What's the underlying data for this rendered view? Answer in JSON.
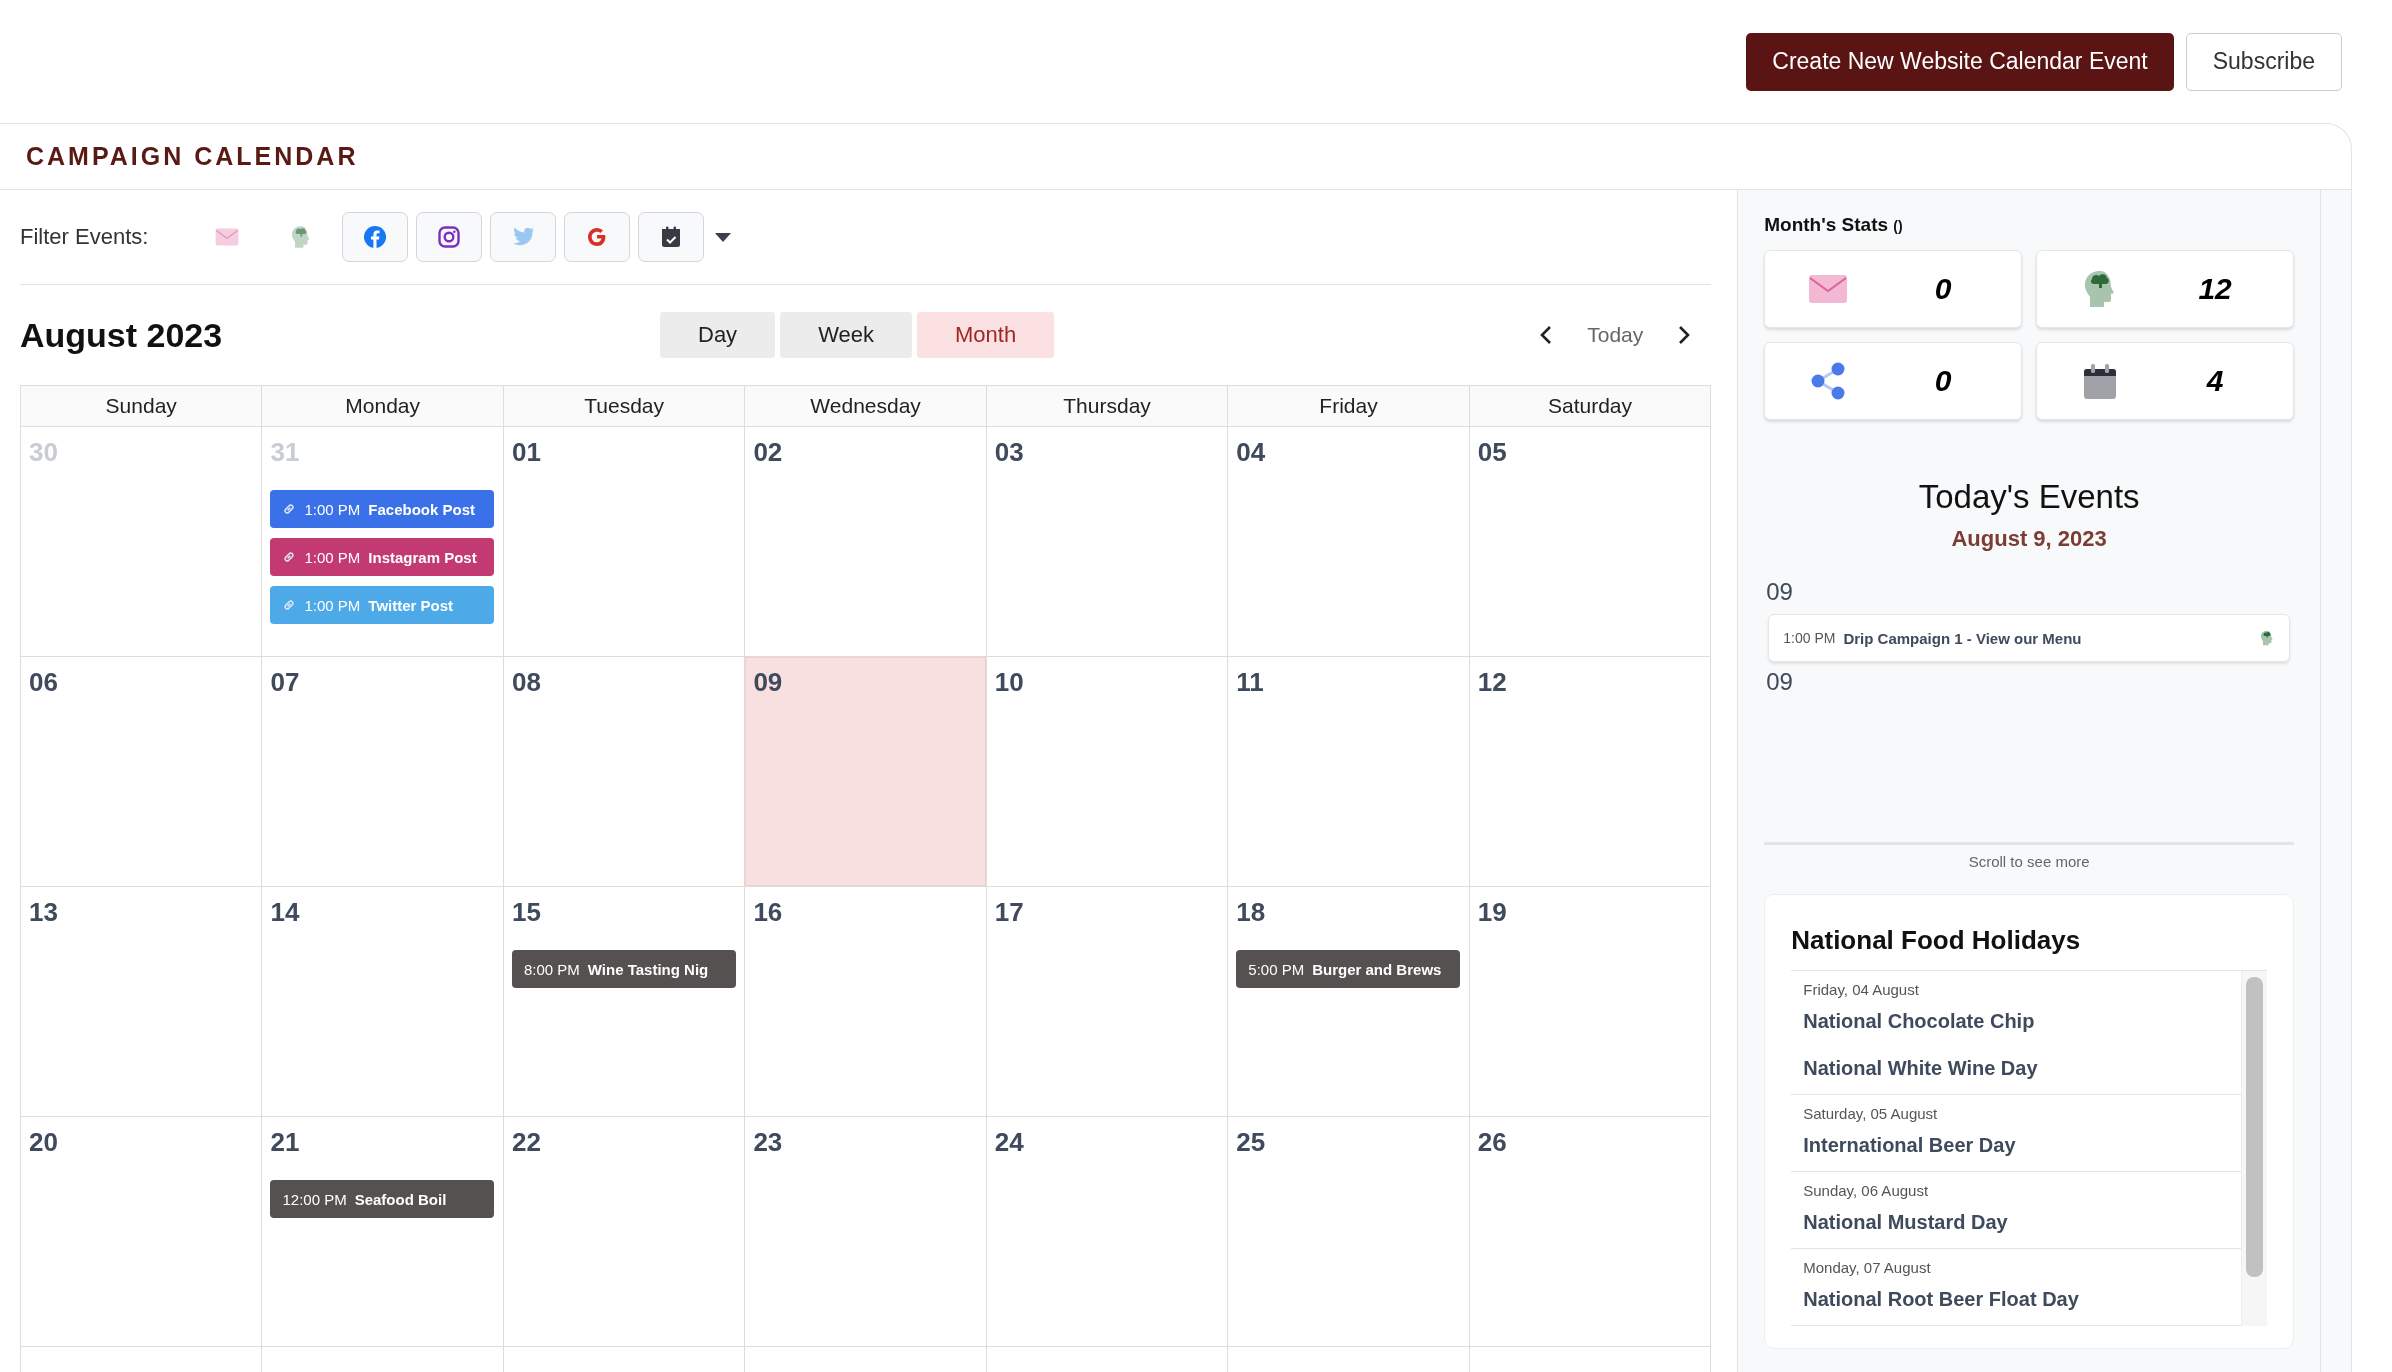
{
  "header_buttons": [
    {
      "label": "Create New Website Calendar Event",
      "kind": "primary"
    },
    {
      "label": "Subscribe",
      "kind": "outline"
    }
  ],
  "title": "CAMPAIGN CALENDAR",
  "filters": {
    "label": "Filter Events:",
    "items": [
      {
        "kind": "email"
      },
      {
        "kind": "drip"
      },
      {
        "kind": "facebook"
      },
      {
        "kind": "instagram"
      },
      {
        "kind": "twitter"
      },
      {
        "kind": "google"
      },
      {
        "kind": "calendar"
      }
    ]
  },
  "calendar": {
    "month_title": "August 2023",
    "views": [
      {
        "label": "Day",
        "selected": false
      },
      {
        "label": "Week",
        "selected": false
      },
      {
        "label": "Month",
        "selected": true
      }
    ],
    "today_button": "Today",
    "weekdays": [
      "Sunday",
      "Monday",
      "Tuesday",
      "Wednesday",
      "Thursday",
      "Friday",
      "Saturday"
    ],
    "weeks": [
      {
        "days": [
          {
            "number": "30",
            "outside": true,
            "today": false
          },
          {
            "number": "31",
            "outside": true,
            "today": false,
            "events": [
              {
                "time": "1:00 PM",
                "title": "Facebook Post",
                "color": "#3b71e8",
                "linked": true
              },
              {
                "time": "1:00 PM",
                "title": "Instagram Post",
                "color": "#c33a72",
                "linked": true
              },
              {
                "time": "1:00 PM",
                "title": "Twitter Post",
                "color": "#4ea9e8",
                "linked": true
              }
            ]
          },
          {
            "number": "01",
            "outside": false,
            "today": false
          },
          {
            "number": "02",
            "outside": false,
            "today": false
          },
          {
            "number": "03",
            "outside": false,
            "today": false
          },
          {
            "number": "04",
            "outside": false,
            "today": false
          },
          {
            "number": "05",
            "outside": false,
            "today": false
          }
        ]
      },
      {
        "days": [
          {
            "number": "06",
            "outside": false,
            "today": false
          },
          {
            "number": "07",
            "outside": false,
            "today": false
          },
          {
            "number": "08",
            "outside": false,
            "today": false
          },
          {
            "number": "09",
            "outside": false,
            "today": true
          },
          {
            "number": "10",
            "outside": false,
            "today": false
          },
          {
            "number": "11",
            "outside": false,
            "today": false
          },
          {
            "number": "12",
            "outside": false,
            "today": false
          }
        ]
      },
      {
        "days": [
          {
            "number": "13",
            "outside": false,
            "today": false
          },
          {
            "number": "14",
            "outside": false,
            "today": false
          },
          {
            "number": "15",
            "outside": false,
            "today": false,
            "events": [
              {
                "time": "8:00 PM",
                "title": "Wine Tasting Nig",
                "color": "#555150",
                "linked": false
              }
            ]
          },
          {
            "number": "16",
            "outside": false,
            "today": false
          },
          {
            "number": "17",
            "outside": false,
            "today": false
          },
          {
            "number": "18",
            "outside": false,
            "today": false,
            "events": [
              {
                "time": "5:00 PM",
                "title": "Burger and Brews",
                "color": "#555150",
                "linked": false
              }
            ]
          },
          {
            "number": "19",
            "outside": false,
            "today": false
          }
        ]
      },
      {
        "days": [
          {
            "number": "20",
            "outside": false,
            "today": false
          },
          {
            "number": "21",
            "outside": false,
            "today": false,
            "events": [
              {
                "time": "12:00 PM",
                "title": "Seafood Boil",
                "color": "#555150",
                "linked": false
              }
            ]
          },
          {
            "number": "22",
            "outside": false,
            "today": false
          },
          {
            "number": "23",
            "outside": false,
            "today": false
          },
          {
            "number": "24",
            "outside": false,
            "today": false
          },
          {
            "number": "25",
            "outside": false,
            "today": false
          },
          {
            "number": "26",
            "outside": false,
            "today": false
          }
        ]
      }
    ]
  },
  "stats": {
    "title": "Month's Stats",
    "suffix": "()",
    "items": [
      {
        "kind": "email",
        "value": "0"
      },
      {
        "kind": "drip",
        "value": "12"
      },
      {
        "kind": "social",
        "value": "0"
      },
      {
        "kind": "calendar",
        "value": "4"
      }
    ]
  },
  "todays_events": {
    "title": "Today's Events",
    "date": "August 9, 2023",
    "groups": [
      {
        "day": "09",
        "events": [
          {
            "time": "1:00 PM",
            "title": "Drip Campaign 1 - View our Menu",
            "kind": "drip"
          }
        ]
      },
      {
        "day": "09"
      }
    ],
    "scroll_hint": "Scroll to see more"
  },
  "holidays": {
    "title": "National Food Holidays",
    "days": [
      {
        "date": "Friday, 04 August",
        "names": [
          "National Chocolate Chip",
          "National White Wine Day"
        ]
      },
      {
        "date": "Saturday, 05 August",
        "names": [
          "International Beer Day"
        ]
      },
      {
        "date": "Sunday, 06 August",
        "names": [
          "National Mustard Day"
        ]
      },
      {
        "date": "Monday, 07 August",
        "names": [
          "National Root Beer Float Day"
        ]
      }
    ]
  }
}
